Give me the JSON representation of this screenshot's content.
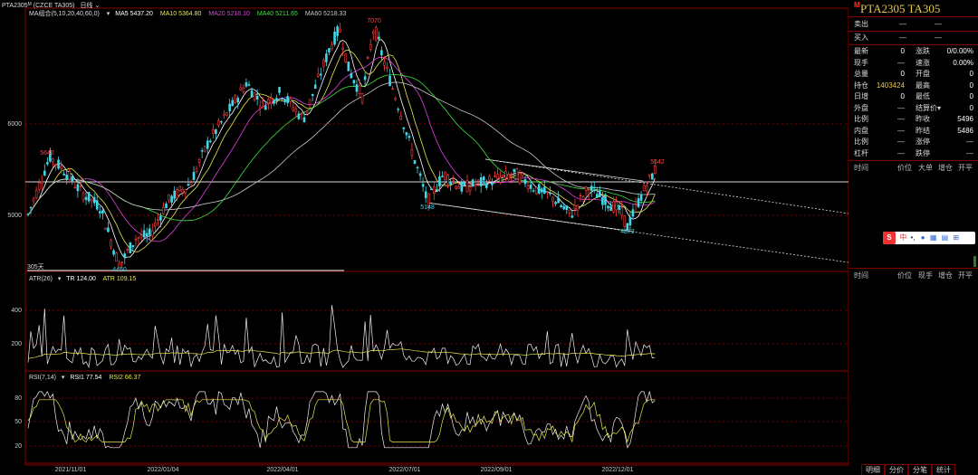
{
  "header": {
    "symbol": "PTA2305",
    "symbol_sup": "M",
    "contract": "(CZCE TA305)",
    "period": "日线"
  },
  "indicators": {
    "ma_label": "MA组合(5,10,20,40,60,0)",
    "ma5": "MA5 5437.20",
    "ma10": "MA10 5364.80",
    "ma20": "MA20 5218.10",
    "ma40": "MA40 5211.65",
    "ma60": "MA60 5218.33",
    "atr_label": "ATR(26)",
    "atr_tr": "TR 124.00",
    "atr_val": "ATR 109.15",
    "rsi_label": "RSI(7,14)",
    "rsi1": "RSI1 77.54",
    "rsi2": "RSI2 66.37"
  },
  "annotations": {
    "high": "7070",
    "a5642": "5642",
    "low4450": "4450",
    "a5148": "5148",
    "a4872": "4872",
    "a5542": "5542",
    "period_note": "305天"
  },
  "axes": {
    "price_ticks": [
      "6000",
      "5000"
    ],
    "atr_ticks": [
      "400",
      "200"
    ],
    "rsi_ticks": [
      "80",
      "50",
      "20"
    ],
    "dates": [
      "2021/11/01",
      "2022/01/04",
      "2022/04/01",
      "2022/07/01",
      "2022/09/01",
      "2022/12/01"
    ]
  },
  "quote": {
    "title": "PTA2305  TA305",
    "mark": "M",
    "sell_label": "卖出",
    "buy_label": "买入",
    "rows": [
      {
        "l1": "最新",
        "v1": "0",
        "l2": "涨跌",
        "v2": "0/0.00%"
      },
      {
        "l1": "现手",
        "v1": "—",
        "l2": "速涨",
        "v2": "0.00%"
      },
      {
        "l1": "总量",
        "v1": "0",
        "l2": "开盘",
        "v2": "0"
      },
      {
        "l1": "持仓",
        "v1": "1403424",
        "l2": "最高",
        "v2": "0"
      },
      {
        "l1": "日增",
        "v1": "0",
        "l2": "最低",
        "v2": "0"
      },
      {
        "l1": "外盘",
        "v1": "—",
        "l2": "结算价▾",
        "v2": "0"
      },
      {
        "l1": "比例",
        "v1": "—",
        "l2": "昨收",
        "v2": "5496"
      },
      {
        "l1": "内盘",
        "v1": "—",
        "l2": "昨结",
        "v2": "5486"
      },
      {
        "l1": "比例",
        "v1": "—",
        "l2": "涨停",
        "v2": "—"
      },
      {
        "l1": "杠杆",
        "v1": "—",
        "l2": "跌停",
        "v2": "—"
      }
    ],
    "tick_headers": [
      "时间",
      "价位",
      "大单",
      "增仓",
      "开平"
    ],
    "tick_headers2": [
      "时间",
      "价位",
      "现手",
      "增仓",
      "开平"
    ]
  },
  "tabs": [
    "明细",
    "分价",
    "分笔",
    "统计"
  ],
  "ime": {
    "logo": "S",
    "cn": "中",
    "dot": "•,"
  },
  "colors": {
    "up": "#ff3c3c",
    "down": "#40d8e8",
    "ma5": "#ffffff",
    "ma10": "#e8e84a",
    "ma20": "#e040e0",
    "ma40": "#40e040",
    "ma60": "#c8c8c8"
  },
  "chart_data": {
    "type": "candlestick",
    "title": "PTA2305 日线",
    "ylim": [
      4300,
      7200
    ],
    "x": [
      "2021/11/01",
      "2022/01/04",
      "2022/04/01",
      "2022/07/01",
      "2022/09/01",
      "2022/12/01"
    ],
    "series": [
      {
        "name": "close",
        "values": [
          5050,
          5642,
          5200,
          4450,
          4800,
          5450,
          6000,
          6900,
          6400,
          7070,
          6500,
          5148,
          5400,
          5300,
          5150,
          4872,
          5542
        ]
      }
    ],
    "annotations": {
      "max": 7070,
      "min": 4450,
      "last_swing": 4872,
      "last": 5542
    },
    "atr": {
      "ylim": [
        0,
        600
      ],
      "ticks": [
        400,
        200
      ],
      "last": 109.15
    },
    "rsi": {
      "ylim": [
        0,
        100
      ],
      "ticks": [
        80,
        50,
        20
      ],
      "rsi1_last": 77.54,
      "rsi2_last": 66.37
    }
  }
}
